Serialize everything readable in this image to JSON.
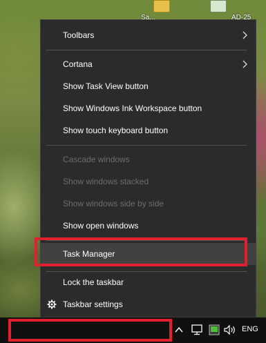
{
  "desktop": {
    "label_1": "Sa...",
    "label_2": "AD-25"
  },
  "context_menu": {
    "items": [
      {
        "label": "Toolbars",
        "enabled": true
      },
      {
        "label": "Cortana",
        "enabled": true
      },
      {
        "label": "Show Task View button",
        "enabled": true
      },
      {
        "label": "Show Windows Ink Workspace button",
        "enabled": true
      },
      {
        "label": "Show touch keyboard button",
        "enabled": true
      },
      {
        "label": "Cascade windows",
        "enabled": false
      },
      {
        "label": "Show windows stacked",
        "enabled": false
      },
      {
        "label": "Show windows side by side",
        "enabled": false
      },
      {
        "label": "Show open windows",
        "enabled": true
      },
      {
        "label": "Task Manager",
        "enabled": true
      },
      {
        "label": "Lock the taskbar",
        "enabled": true
      },
      {
        "label": "Taskbar settings",
        "enabled": true
      }
    ]
  },
  "taskbar": {
    "language": "ENG"
  },
  "colors": {
    "menu_bg": "#2b2b2b",
    "highlight": "#e0202e",
    "disabled_text": "#6d6d6d"
  },
  "icons": [
    "chevron-right-icon",
    "gear-icon",
    "tray-chevron-up-icon",
    "network-icon",
    "app-tray-icon",
    "volume-icon"
  ]
}
